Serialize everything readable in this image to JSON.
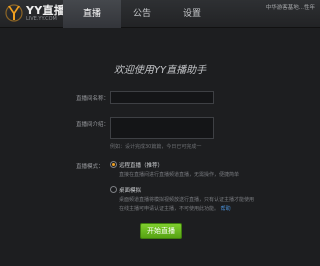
{
  "app": {
    "logo_title": "YY直播",
    "logo_sub": "LIVE.YY.COM",
    "brand_color": "#f0a020"
  },
  "tabs": [
    {
      "label": "直播",
      "active": true
    },
    {
      "label": "公告",
      "active": false
    },
    {
      "label": "设置",
      "active": false
    }
  ],
  "account": {
    "text": "中华游客基地...性年"
  },
  "main": {
    "welcome": "欢迎使用YY直播助手",
    "room_name": {
      "label": "直播间名称：",
      "value": ""
    },
    "room_intro": {
      "label": "直播间介绍：",
      "value": ""
    },
    "hint": "例如：设计完成30篇篇，今日已可完成一",
    "mode_label": "直播模式：",
    "options": [
      {
        "title": "远程直播（推荐）",
        "checked": true,
        "desc": [
          "直接在直播间进行直播频道直播，无需操作，便捷简单"
        ]
      },
      {
        "title": "桌面模拟",
        "checked": false,
        "desc": [
          "桌面频道直播将模拟视频放送行直播，只有认证主播才能使用",
          "在线主播可申请认证主播，不可使用此功能。"
        ],
        "link": "帮助"
      }
    ],
    "start_button": "开始直播"
  }
}
